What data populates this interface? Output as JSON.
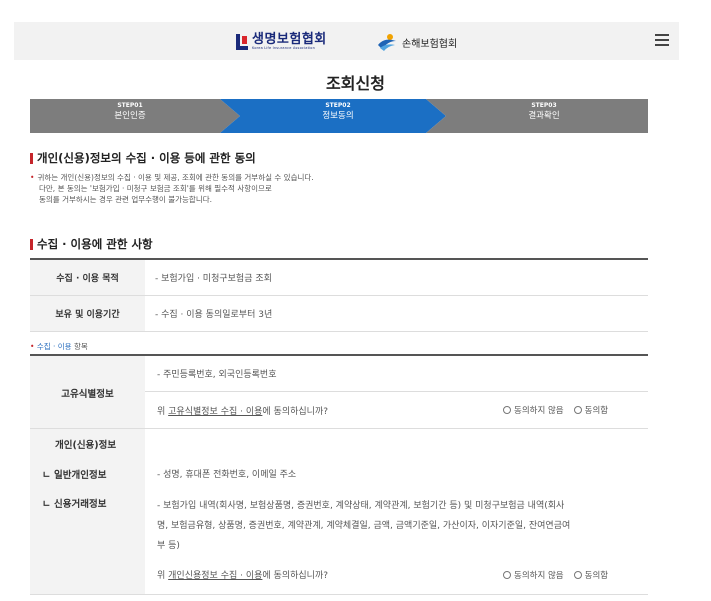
{
  "header": {
    "logo_life_name": "생명보험협회",
    "logo_life_sub": "Korea Life Insurance Association",
    "logo_nonlife_name": "손해보험협회"
  },
  "page_title": "조회신청",
  "steps": [
    {
      "num": "STEP01",
      "label": "본인인증",
      "state": "done"
    },
    {
      "num": "STEP02",
      "label": "정보동의",
      "state": "active"
    },
    {
      "num": "STEP03",
      "label": "결과확인",
      "state": "todo"
    }
  ],
  "colors": {
    "active_step": "#1b6fc4",
    "inactive_step": "#7d7d7d",
    "accent_red": "#c5252b"
  },
  "consent_section": {
    "title": "개인(신용)정보의 수집 · 이용 등에 관한 동의",
    "notes": [
      "귀하는 개인(신용)정보의 수집 · 이용 및 제공, 조회에 관한 동의를 거부하실 수 있습니다.",
      "다만, 본 동의는 '보험가입 · 미청구 보험금 조회'를 위해 필수적 사항이므로",
      "동의를 거부하시는 경우 관련 업무수행이 불가능합니다."
    ]
  },
  "collection_section": {
    "title": "수집 · 이용에 관한 사항",
    "rows": [
      {
        "header": "수집 · 이용 목적",
        "value": "- 보험가입 · 미청구보험금 조회"
      },
      {
        "header": "보유 및 이용기간",
        "value": "- 수집 · 이용 동의일로부터 3년"
      }
    ]
  },
  "items": {
    "label_prefix": "• ",
    "label_highlight": "수집 · 이용",
    "label_suffix": " 항목",
    "unique_id": {
      "header": "고유식별정보",
      "value": "- 주민등록번호, 외국인등록번호",
      "question_prefix": "위 ",
      "question_link": "고유식별정보 수집 · 이용",
      "question_suffix": "에 동의하십니까?",
      "disagree": "동의하지 않음",
      "agree": "동의함"
    },
    "personal_info": {
      "header": "개인(신용)정보",
      "sub1_header": "ㄴ 일반개인정보",
      "sub1_value": "- 성명, 휴대폰 전화번호, 이메일 주소",
      "sub2_header": "ㄴ 신용거래정보",
      "sub2_value_line1": "- 보험가입 내역(회사명, 보험상품명, 증권번호, 계약상태, 계약관계, 보험기간 등) 및 미청구보험금 내역(회사",
      "sub2_value_line2": "명, 보험금유형, 상품명, 증권번호, 계약관계, 계약체결일, 금액, 금액기준일, 가산이자, 이자기준일, 잔여연금여",
      "sub2_value_line3": "부 등)",
      "question_prefix": "위 ",
      "question_link": "개인신용정보 수집 · 이용",
      "question_suffix": "에 동의하십니까?",
      "disagree": "동의하지 않음",
      "agree": "동의함"
    }
  }
}
